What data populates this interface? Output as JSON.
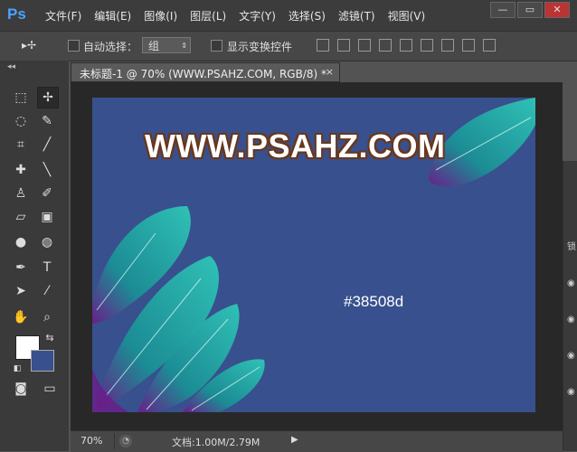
{
  "app": {
    "logo": "Ps"
  },
  "menu": [
    "文件(F)",
    "编辑(E)",
    "图像(I)",
    "图层(L)",
    "文字(Y)",
    "选择(S)",
    "滤镜(T)",
    "视图(V)"
  ],
  "window_buttons": {
    "minimize": "—",
    "restore": "▭",
    "close": "✕"
  },
  "options": {
    "tool_glyph": "▸✢",
    "auto_select_label": "自动选择：",
    "auto_select_value": "组",
    "show_transform_label": "显示变换控件"
  },
  "document": {
    "tab_title": "未标题-1 @ 70% (WWW.PSAHZ.COM, RGB/8) *",
    "tab_close": "×"
  },
  "canvas": {
    "bg_color": "#38508d",
    "watermark": "WWW.PSAHZ.COM",
    "hex_label": "#38508d"
  },
  "colors": {
    "foreground": "#ffffff",
    "background": "#38508d",
    "feather": "#1eb3a8",
    "feather_dark": "#6a1d8a"
  },
  "status": {
    "zoom": "70%",
    "doc_info": "文档:1.00M/2.79M",
    "arrow": "▶"
  },
  "right_panel": {
    "label": "锁"
  }
}
